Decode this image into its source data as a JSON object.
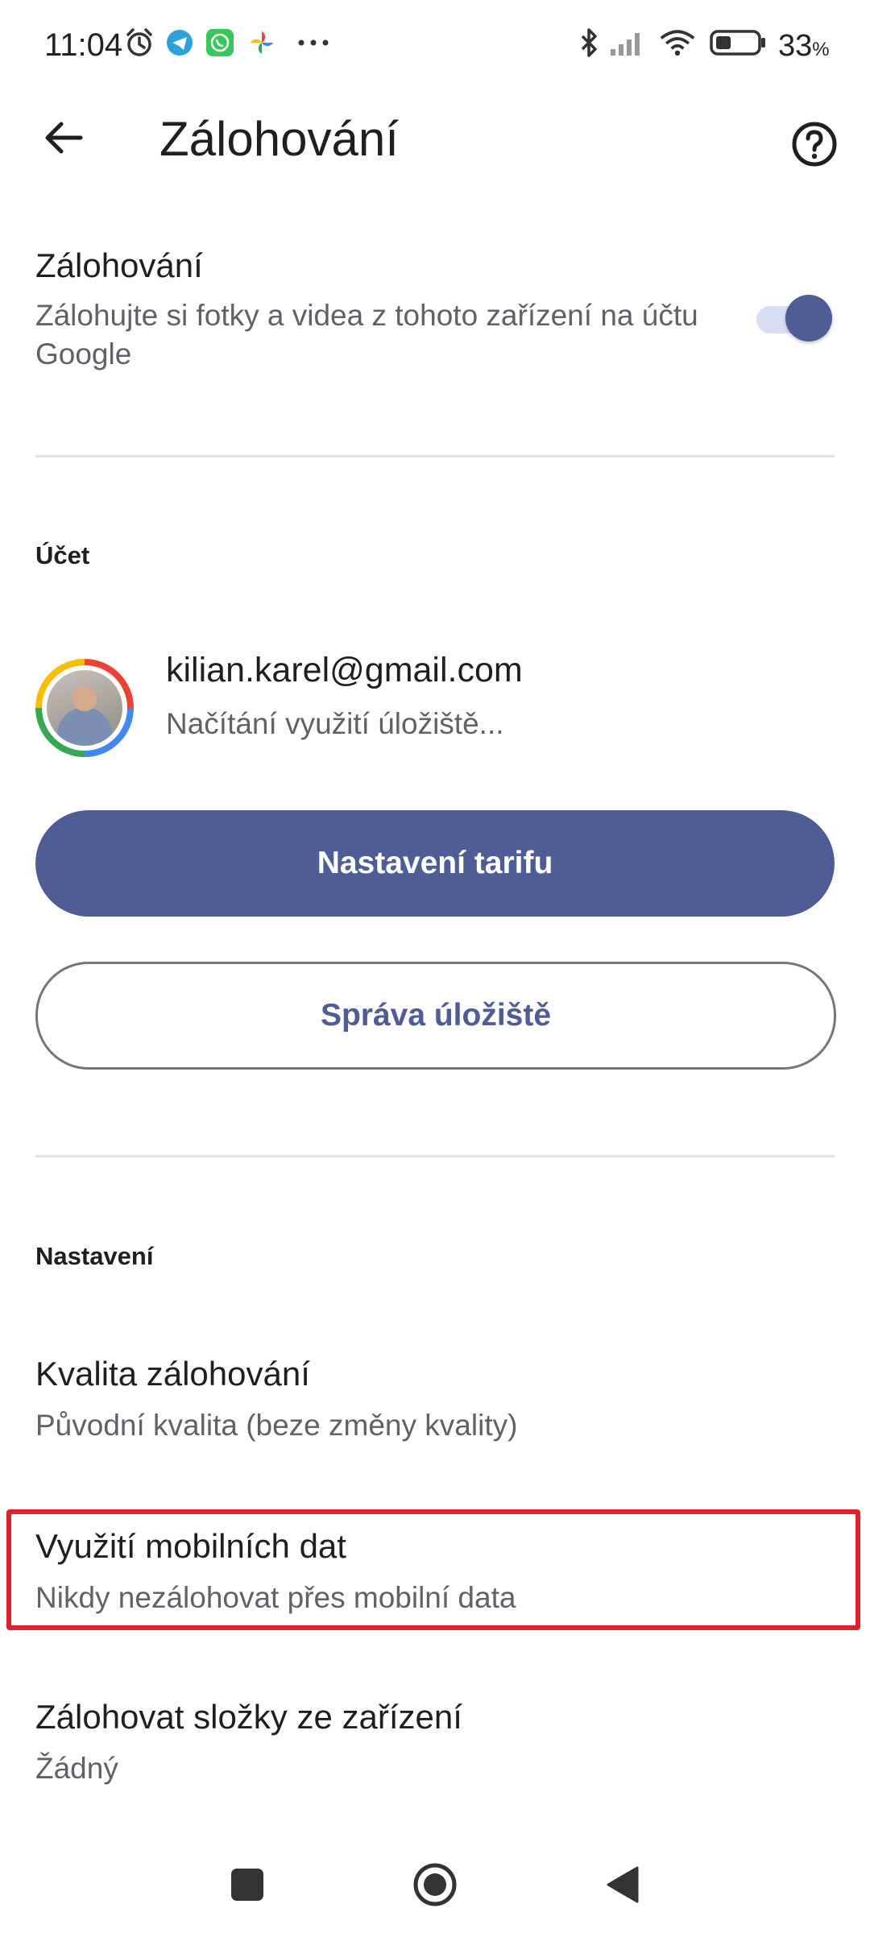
{
  "status_bar": {
    "time": "11:04",
    "battery_percent": "33",
    "battery_unit": "%",
    "icons": [
      "alarm-icon",
      "telegram-icon",
      "whatsapp-icon",
      "google-photos-icon",
      "more-dots-icon",
      "bluetooth-icon",
      "signal-icon",
      "wifi-icon",
      "battery-icon"
    ]
  },
  "app_bar": {
    "title": "Zálohování",
    "back_icon": "arrow-back-icon",
    "help_icon": "help-circle-icon"
  },
  "backup": {
    "title": "Zálohování",
    "subtitle": "Zálohujte si fotky a videa z tohoto zařízení na účtu Google",
    "enabled": true
  },
  "account_section": {
    "label": "Účet",
    "email": "kilian.karel@gmail.com",
    "storage_status": "Načítání využití úložiště...",
    "plan_button": "Nastavení tarifu",
    "storage_button": "Správa úložiště"
  },
  "settings_section": {
    "label": "Nastavení",
    "items": [
      {
        "title": "Kvalita zálohování",
        "subtitle": "Původní kvalita (beze změny kvality)"
      },
      {
        "title": "Využití mobilních dat",
        "subtitle": "Nikdy nezálohovat přes mobilní data"
      },
      {
        "title": "Zálohovat složky ze zařízení",
        "subtitle": "Žádný"
      }
    ]
  },
  "colors": {
    "accent": "#4e5d95",
    "highlight": "#e0202b",
    "toggle_track": "#d9ddf6"
  },
  "nav_bar": {
    "icons": [
      "recents-square-icon",
      "home-circle-icon",
      "back-triangle-icon"
    ]
  }
}
